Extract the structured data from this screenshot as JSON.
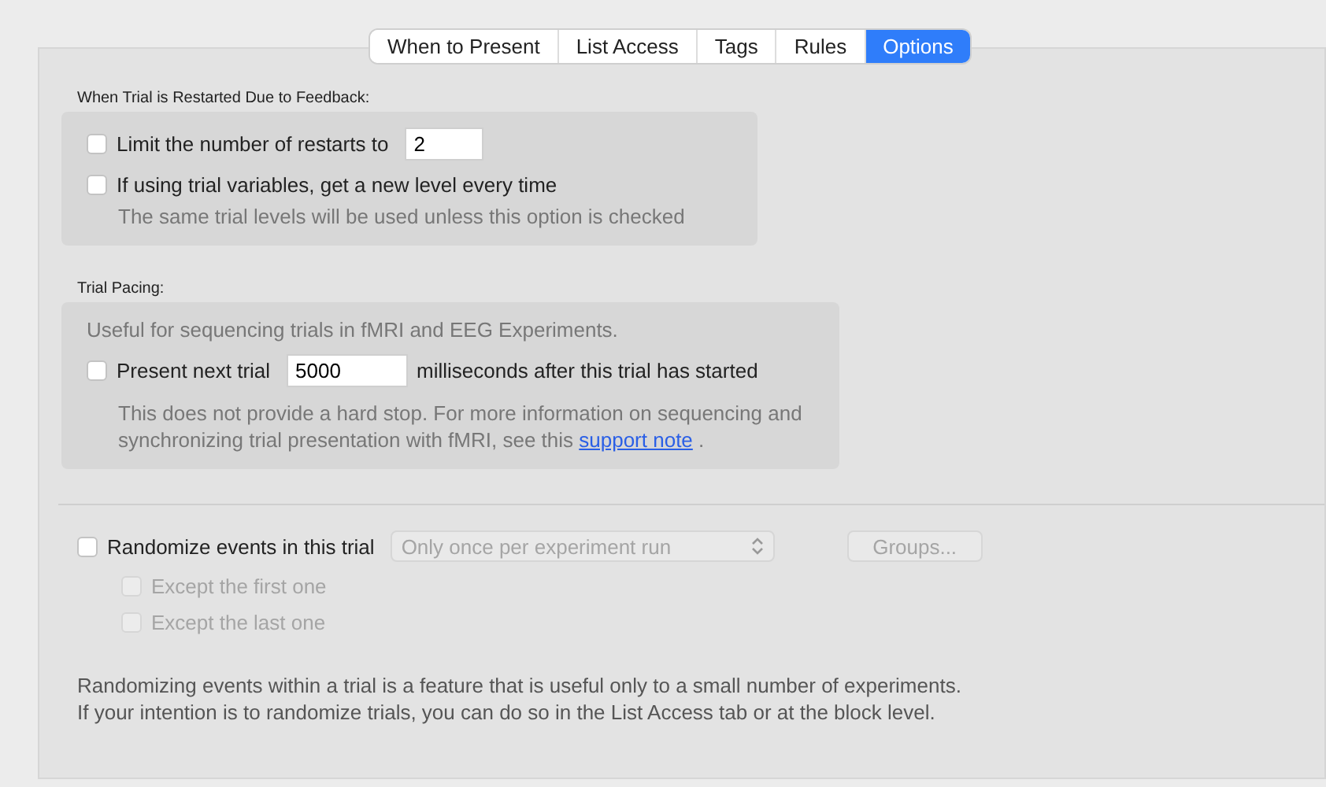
{
  "tabs": [
    {
      "label": "When to Present",
      "selected": false
    },
    {
      "label": "List Access",
      "selected": false
    },
    {
      "label": "Tags",
      "selected": false
    },
    {
      "label": "Rules",
      "selected": false
    },
    {
      "label": "Options",
      "selected": true
    }
  ],
  "restart": {
    "heading": "When Trial is Restarted Due to Feedback:",
    "limit": {
      "label": "Limit the number of restarts to",
      "checked": false,
      "value": "2"
    },
    "new_level": {
      "label": "If using trial variables, get a new level every time",
      "checked": false
    },
    "hint": "The same trial levels will be used unless this option is checked"
  },
  "pacing": {
    "heading": "Trial Pacing:",
    "intro": "Useful for sequencing trials in fMRI and EEG Experiments.",
    "present": {
      "label": "Present next trial",
      "checked": false,
      "value": "5000",
      "suffix": "milliseconds after this trial has started"
    },
    "note": "This does not provide a hard stop. For more information on sequencing and synchronizing trial presentation with fMRI, see this",
    "link": "support note",
    "after_link": "."
  },
  "randomize": {
    "label": "Randomize events in this trial",
    "checked": false,
    "select": {
      "value": "Only once per experiment run",
      "disabled": true
    },
    "groups_button": {
      "label": "Groups...",
      "disabled": true
    },
    "options": [
      {
        "label": "Except the first one",
        "checked": false,
        "disabled": true
      },
      {
        "label": "Except the last one",
        "checked": false,
        "disabled": true
      }
    ],
    "note_lines": [
      "Randomizing events within a trial is a feature that is useful only to a small number of experiments.",
      "If your intention is to randomize trials, you can do so in the List Access tab or at the block level."
    ]
  }
}
